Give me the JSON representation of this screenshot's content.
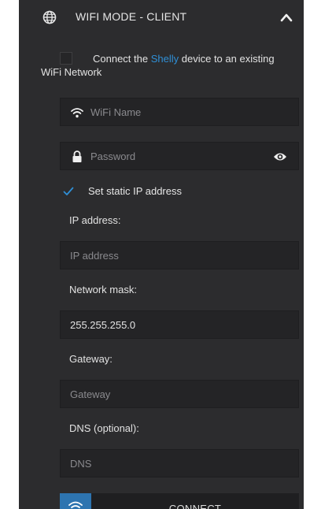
{
  "header": {
    "title": "WIFI MODE - CLIENT"
  },
  "connect": {
    "prefix": "Connect the ",
    "brand": "Shelly",
    "suffix": " device to an existing WiFi Network",
    "checked": false
  },
  "wifi_name": {
    "placeholder": "WiFi Name",
    "value": ""
  },
  "password": {
    "placeholder": "Password",
    "value": ""
  },
  "static_ip": {
    "label": "Set static IP address",
    "checked": true
  },
  "ip_address": {
    "label": "IP address:",
    "placeholder": "IP address",
    "value": ""
  },
  "network_mask": {
    "label": "Network mask:",
    "placeholder": "",
    "value": "255.255.255.0"
  },
  "gateway": {
    "label": "Gateway:",
    "placeholder": "Gateway",
    "value": ""
  },
  "dns": {
    "label": "DNS (optional):",
    "placeholder": "DNS",
    "value": ""
  },
  "connect_button": {
    "label": "CONNECT"
  },
  "colors": {
    "accent": "#2f8fd6",
    "panel": "#2c2c2e",
    "button_icon_bg": "#2d74b0"
  },
  "icons": [
    "globe-icon",
    "chevron-up-icon",
    "wifi-icon",
    "lock-icon",
    "eye-icon",
    "checkmark-icon",
    "wifi-button-icon"
  ]
}
